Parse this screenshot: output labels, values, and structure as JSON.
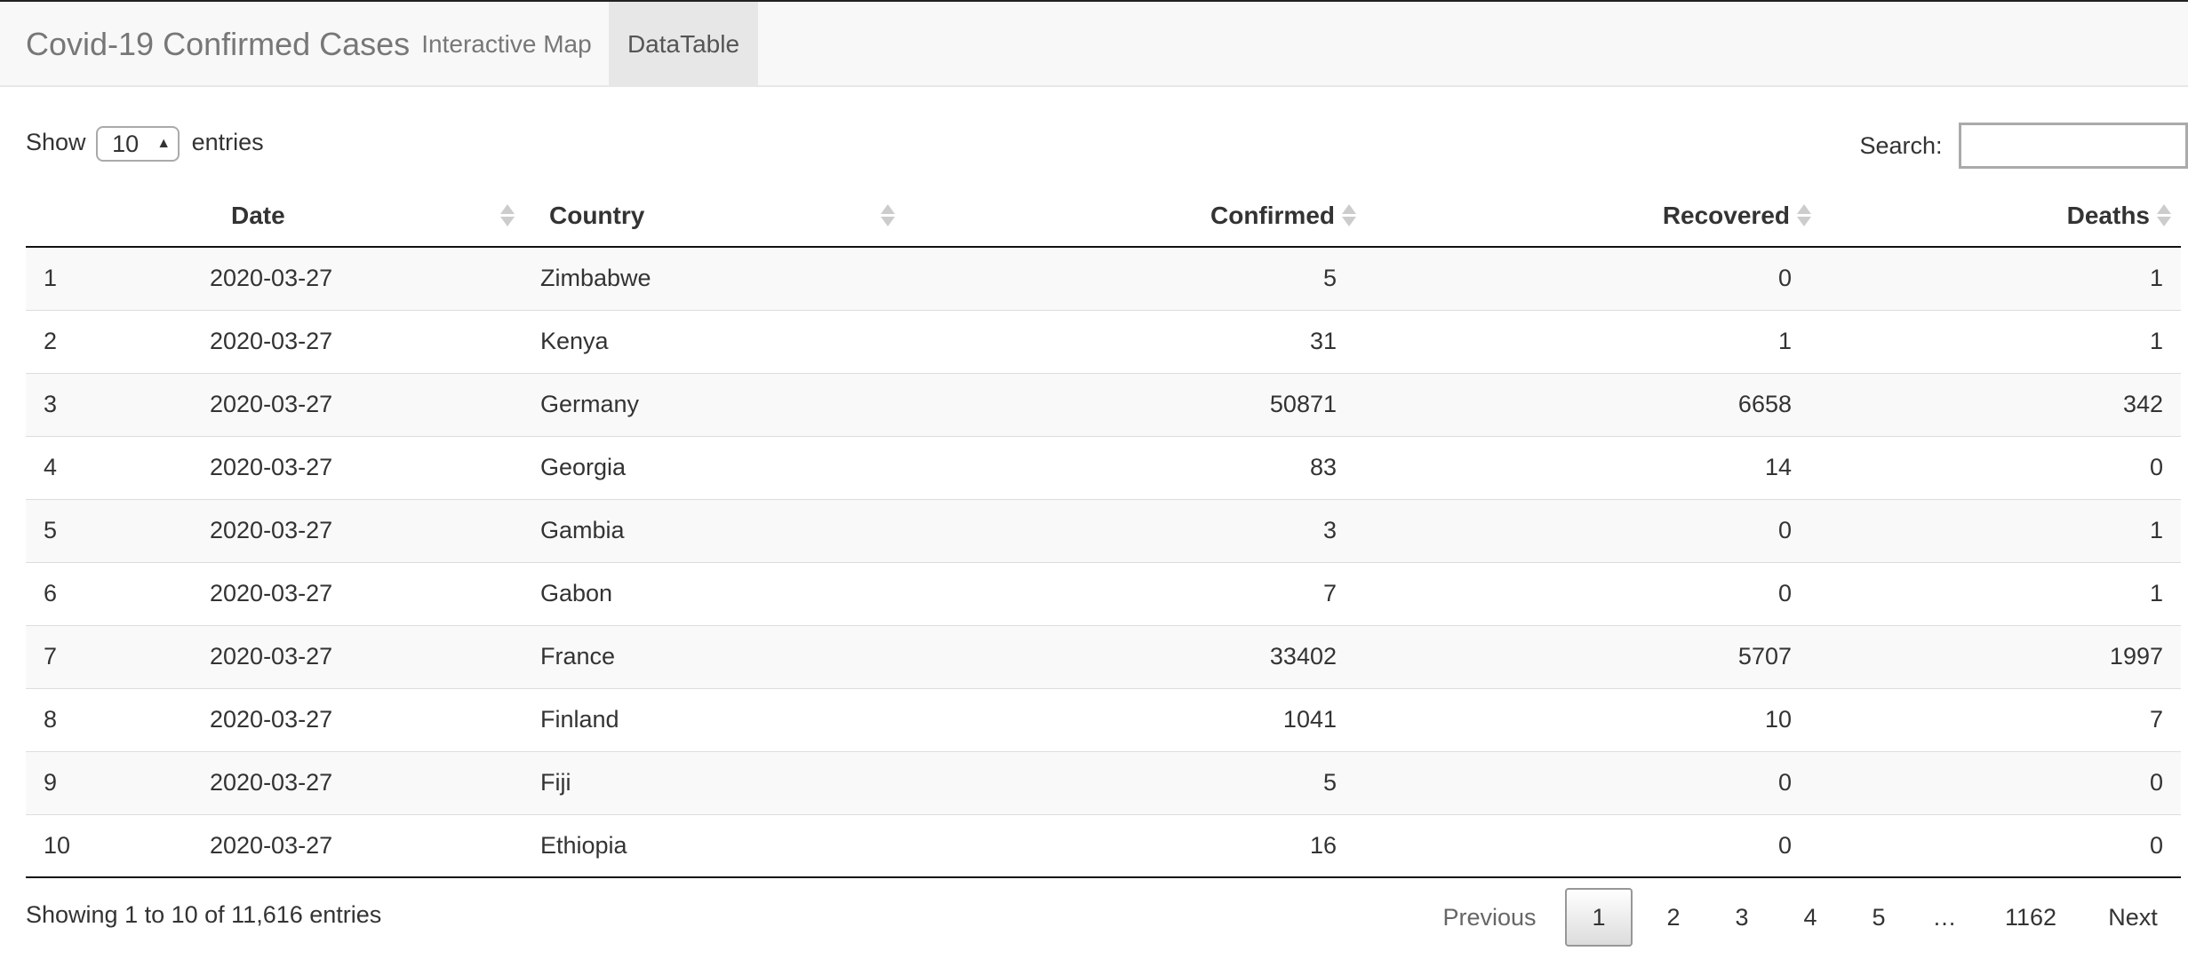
{
  "navbar": {
    "brand": "Covid-19 Confirmed Cases",
    "tabs": [
      {
        "label": "Interactive Map",
        "active": false
      },
      {
        "label": "DataTable",
        "active": true
      }
    ]
  },
  "controls": {
    "show_label": "Show",
    "entries_label": "entries",
    "length_value": "10",
    "search_label": "Search:",
    "search_value": ""
  },
  "table": {
    "columns": [
      "",
      "Date",
      "Country",
      "Confirmed",
      "Recovered",
      "Deaths"
    ],
    "rows": [
      [
        "1",
        "2020-03-27",
        "Zimbabwe",
        "5",
        "0",
        "1"
      ],
      [
        "2",
        "2020-03-27",
        "Kenya",
        "31",
        "1",
        "1"
      ],
      [
        "3",
        "2020-03-27",
        "Germany",
        "50871",
        "6658",
        "342"
      ],
      [
        "4",
        "2020-03-27",
        "Georgia",
        "83",
        "14",
        "0"
      ],
      [
        "5",
        "2020-03-27",
        "Gambia",
        "3",
        "0",
        "1"
      ],
      [
        "6",
        "2020-03-27",
        "Gabon",
        "7",
        "0",
        "1"
      ],
      [
        "7",
        "2020-03-27",
        "France",
        "33402",
        "5707",
        "1997"
      ],
      [
        "8",
        "2020-03-27",
        "Finland",
        "1041",
        "10",
        "7"
      ],
      [
        "9",
        "2020-03-27",
        "Fiji",
        "5",
        "0",
        "0"
      ],
      [
        "10",
        "2020-03-27",
        "Ethiopia",
        "16",
        "0",
        "0"
      ]
    ]
  },
  "footer": {
    "info": "Showing 1 to 10 of 11,616 entries",
    "pagination": {
      "previous": "Previous",
      "pages": [
        "1",
        "2",
        "3",
        "4",
        "5"
      ],
      "ellipsis": "…",
      "last_page": "1162",
      "next": "Next",
      "current": "1"
    }
  },
  "colors": {
    "navbar_bg": "#f8f8f8",
    "active_tab_bg": "#e7e7e7",
    "stripe_bg": "#f9f9f9"
  }
}
